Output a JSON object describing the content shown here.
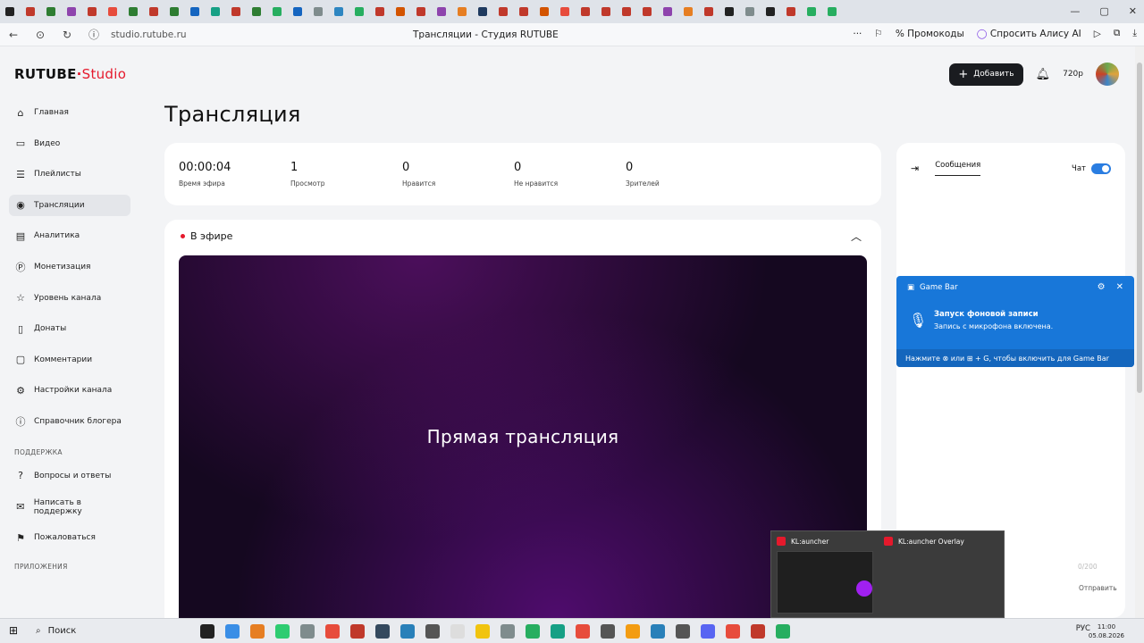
{
  "browser": {
    "url": "studio.rutube.ru",
    "title": "Трансляции - Студия RUTUBE",
    "promo": "Промокоды",
    "alice": "Спросить Алису AI"
  },
  "brand": {
    "name": "RUTUBE",
    "sub": "Studio",
    "accent": "#e5192c"
  },
  "header": {
    "add_label": "Добавить",
    "quality": "720p"
  },
  "sidebar": {
    "items": [
      {
        "label": "Главная",
        "icon": "home-icon",
        "glyph": "⌂"
      },
      {
        "label": "Видео",
        "icon": "video-icon",
        "glyph": "▭"
      },
      {
        "label": "Плейлисты",
        "icon": "playlist-icon",
        "glyph": "☰"
      },
      {
        "label": "Трансляции",
        "icon": "broadcast-icon",
        "glyph": "◉",
        "active": true
      },
      {
        "label": "Аналитика",
        "icon": "analytics-icon",
        "glyph": "▤"
      },
      {
        "label": "Монетизация",
        "icon": "money-icon",
        "glyph": "Ⓟ"
      },
      {
        "label": "Уровень канала",
        "icon": "star-icon",
        "glyph": "☆"
      },
      {
        "label": "Донаты",
        "icon": "donate-icon",
        "glyph": "▯"
      },
      {
        "label": "Комментарии",
        "icon": "comments-icon",
        "glyph": "▢"
      },
      {
        "label": "Настройки канала",
        "icon": "gear-icon",
        "glyph": "⚙"
      },
      {
        "label": "Справочник блогера",
        "icon": "info-icon",
        "glyph": "ⓘ"
      }
    ],
    "support_title": "ПОДДЕРЖКА",
    "support": [
      {
        "label": "Вопросы и ответы",
        "icon": "question-icon",
        "glyph": "?"
      },
      {
        "label": "Написать в поддержку",
        "icon": "mail-icon",
        "glyph": "✉"
      },
      {
        "label": "Пожаловаться",
        "icon": "flag-icon",
        "glyph": "⚑"
      }
    ],
    "apps_title": "ПРИЛОЖЕНИЯ"
  },
  "page": {
    "title": "Трансляция"
  },
  "stats": [
    {
      "value": "00:00:04",
      "label": "Время эфира"
    },
    {
      "value": "1",
      "label": "Просмотр"
    },
    {
      "value": "0",
      "label": "Нравится"
    },
    {
      "value": "0",
      "label": "Не нравится"
    },
    {
      "value": "0",
      "label": "Зрителей"
    }
  ],
  "live": {
    "status": "В эфире",
    "player_text": "Прямая трансляция"
  },
  "chat": {
    "tab": "Сообщения",
    "toggle_label": "Чат",
    "counter": "0/200",
    "send": "Отправить"
  },
  "gamebar": {
    "title": "Game Bar",
    "headline": "Запуск фоновой записи",
    "note": "Запись с микрофона включена.",
    "footer": "Нажмите ⊗ или ⊞ + G, чтобы включить для Game Bar"
  },
  "thumbs": [
    {
      "title": "KL:auncher"
    },
    {
      "title": "KL:auncher Overlay"
    }
  ],
  "taskbar": {
    "search": "Поиск",
    "lang": "РУС",
    "time": "11:00",
    "date": "05.08.2026"
  }
}
